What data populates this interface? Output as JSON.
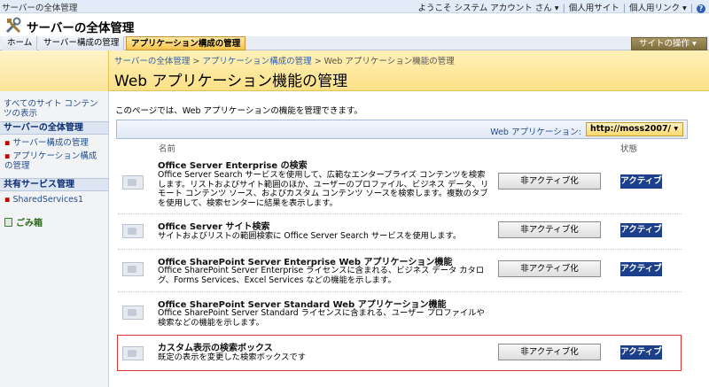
{
  "global": {
    "site_breadcrumb": "サーバーの全体管理",
    "welcome": "ようこそ システム アカウント さん ▾",
    "my_site": "個人用サイト",
    "my_links": "個人用リンク ▾",
    "help_icon": "help-icon"
  },
  "header": {
    "site_title": "サーバーの全体管理"
  },
  "tabs": [
    {
      "label": "ホーム"
    },
    {
      "label": "サーバー構成の管理"
    },
    {
      "label": "アプリケーション構成の管理",
      "selected": true
    }
  ],
  "site_actions": "サイトの操作 ▾",
  "breadcrumb": {
    "items": [
      "サーバーの全体管理",
      "アプリケーション構成の管理"
    ],
    "current": "Web アプリケーション機能の管理",
    "separator": ">"
  },
  "page_title": "Web アプリケーション機能の管理",
  "leftnav": {
    "view_all": "すべてのサイト コンテンツの表示",
    "section1": "サーバーの全体管理",
    "items1": [
      "サーバー構成の管理",
      "アプリケーション構成の管理"
    ],
    "section2": "共有サービス管理",
    "items2": [
      "SharedServices1"
    ],
    "recycle": "ごみ箱"
  },
  "main": {
    "description": "このページでは、Web アプリケーションの機能を管理できます。",
    "webapp_label": "Web アプリケーション:",
    "webapp_value": "http://moss2007/ ▾",
    "col_name": "名前",
    "col_status": "状態",
    "features": [
      {
        "name": "Office Server Enterprise の検索",
        "desc": "Office Server Search サービスを使用して、広範なエンタープライズ コンテンツを検索します。リストおよびサイト範囲のほか、ユーザーのプロファイル、ビジネス データ、リモート コンテンツ ソース、およびカスタム コンテンツ ソースを検索します。複数のタブを使用して、検索センターに結果を表示します。",
        "button": "非アクティブ化",
        "status": "アクティブ"
      },
      {
        "name": "Office Server サイト検索",
        "desc": "サイトおよびリストの範囲検索に Office Server Search サービスを使用します。",
        "button": "非アクティブ化",
        "status": "アクティブ"
      },
      {
        "name": "Office SharePoint Server Enterprise Web アプリケーション機能",
        "desc": "Office SharePoint Server Enterprise ライセンスに含まれる、ビジネス データ カタログ、Forms Services、Excel Services などの機能を示します。",
        "button": "非アクティブ化",
        "status": "アクティブ"
      },
      {
        "name": "Office SharePoint Server Standard Web アプリケーション機能",
        "desc": "Office SharePoint Server Standard ライセンスに含まれる、ユーザー プロファイルや検索などの機能を示します。",
        "button": "",
        "status": ""
      },
      {
        "name": "カスタム表示の検索ボックス",
        "desc": "既定の表示を変更した検索ボックスです",
        "button": "非アクティブ化",
        "status": "アクティブ"
      }
    ]
  },
  "colors": {
    "accent_blue": "#1c3f8c",
    "highlight_red": "#e03030",
    "tab_selected": "#f7c44a"
  }
}
